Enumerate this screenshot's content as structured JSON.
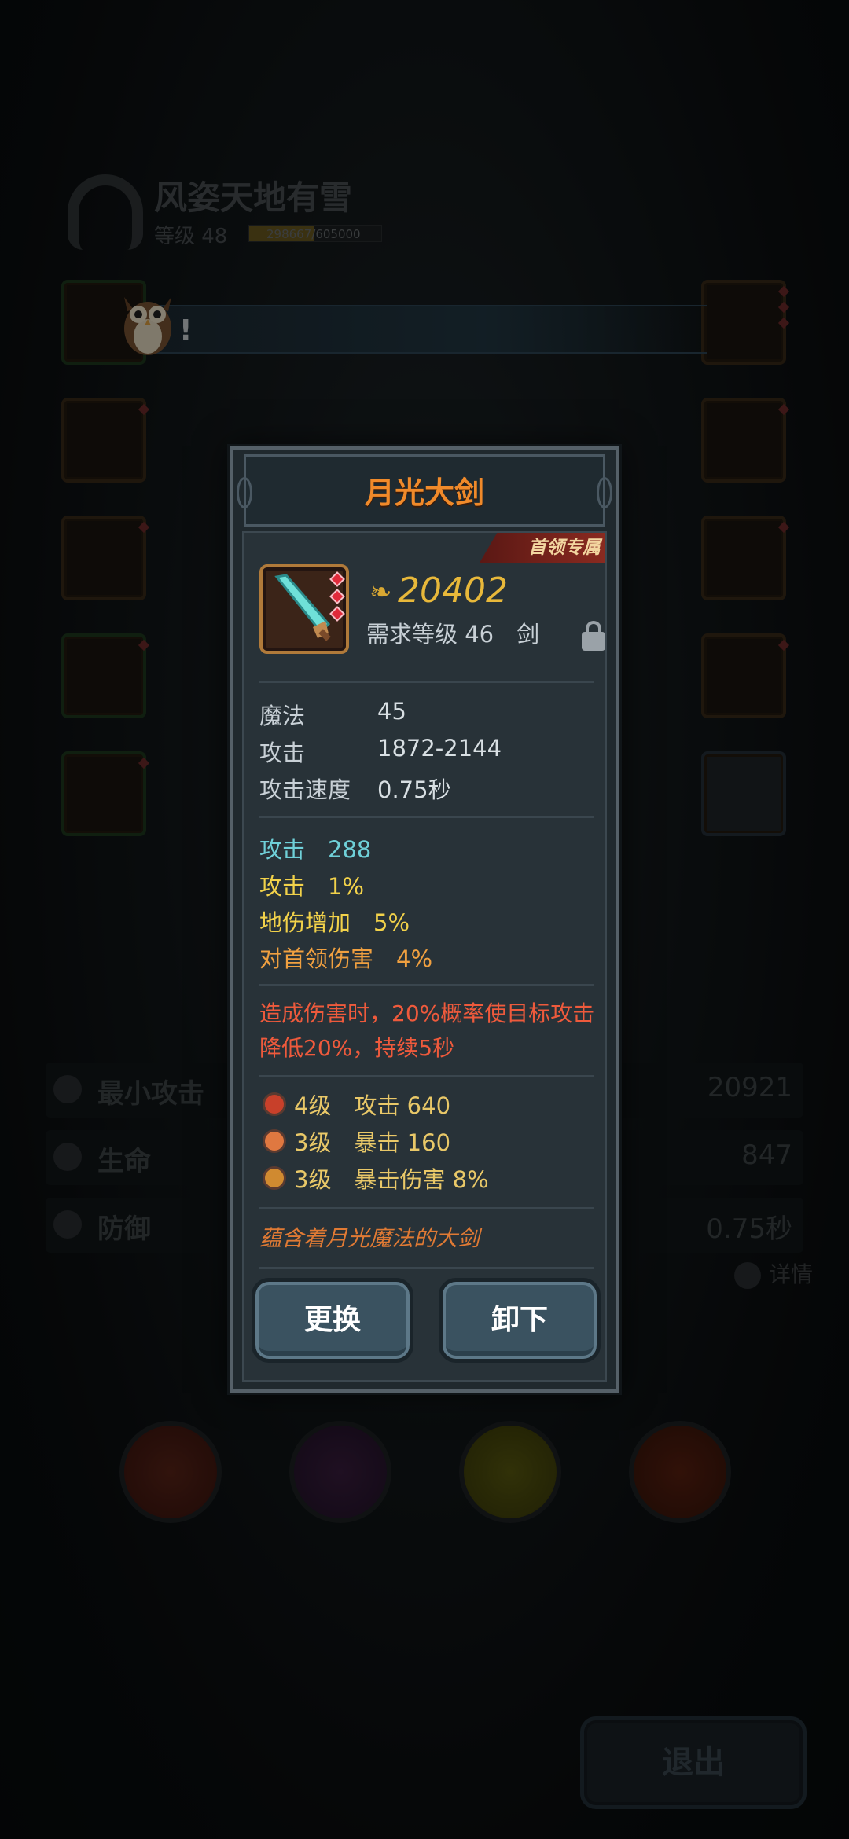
{
  "player": {
    "name": "风姿天地有雪",
    "level_text": "等级 48",
    "xp_text": "298667/605000",
    "xp_progress": 0.4937
  },
  "stats": [
    {
      "label": "最小攻击",
      "value": "20921",
      "icon": "sword-icon"
    },
    {
      "label": "生命",
      "value": "847",
      "icon": "heart-icon"
    },
    {
      "label": "防御",
      "value": "0.75秒",
      "icon": "shield-icon"
    }
  ],
  "detail_label": "详情",
  "exit_label": "退出",
  "dialog_mark": "!",
  "modal": {
    "title": "月光大剑",
    "badge": "首领专属",
    "price": "20402",
    "requirement": "需求等级 46　剑",
    "base_stats": [
      {
        "key": "魔法",
        "value": "45"
      },
      {
        "key": "攻击",
        "value": "1872-2144"
      },
      {
        "key": "攻击速度",
        "value": "0.75秒"
      }
    ],
    "affixes": [
      {
        "text": "攻击　288",
        "color": "#6fd0d8"
      },
      {
        "text": "攻击　1%",
        "color": "#f2d24a"
      },
      {
        "text": "地伤增加　5%",
        "color": "#f2d24a"
      },
      {
        "text": "对首领伤害　4%",
        "color": "#f0a040"
      }
    ],
    "effect": "造成伤害时，20%概率使目标攻击降低20%，持续5秒",
    "sockets": [
      {
        "text": "4级　攻击 640",
        "icon": "ruby-gem-icon",
        "color": "#c8402a"
      },
      {
        "text": "3级　暴击 160",
        "icon": "amber-gem-icon",
        "color": "#e07840"
      },
      {
        "text": "3级　暴击伤害 8%",
        "icon": "orb-gem-icon",
        "color": "#d08a30"
      }
    ],
    "flavor": "蕴含着月光魔法的大剑",
    "btn_replace": "更换",
    "btn_unequip": "卸下"
  },
  "colors": {
    "title": "#f08a2a",
    "price": "#e8b83a",
    "effect": "#ee5a3c",
    "flavor": "#e07a34",
    "socket_text": "#e9c868"
  }
}
